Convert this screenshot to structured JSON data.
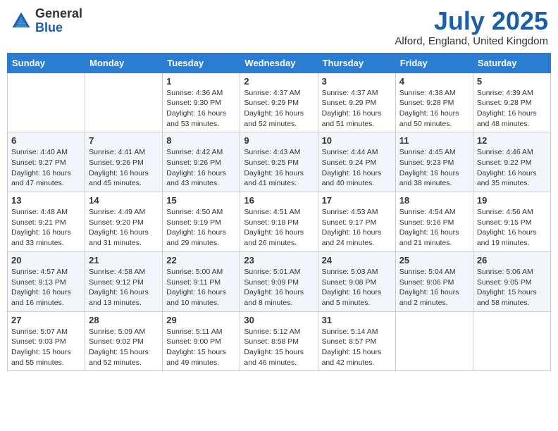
{
  "header": {
    "logo_general": "General",
    "logo_blue": "Blue",
    "month_title": "July 2025",
    "location": "Alford, England, United Kingdom"
  },
  "days_of_week": [
    "Sunday",
    "Monday",
    "Tuesday",
    "Wednesday",
    "Thursday",
    "Friday",
    "Saturday"
  ],
  "weeks": [
    [
      {
        "day": "",
        "info": ""
      },
      {
        "day": "",
        "info": ""
      },
      {
        "day": "1",
        "info": "Sunrise: 4:36 AM\nSunset: 9:30 PM\nDaylight: 16 hours and 53 minutes."
      },
      {
        "day": "2",
        "info": "Sunrise: 4:37 AM\nSunset: 9:29 PM\nDaylight: 16 hours and 52 minutes."
      },
      {
        "day": "3",
        "info": "Sunrise: 4:37 AM\nSunset: 9:29 PM\nDaylight: 16 hours and 51 minutes."
      },
      {
        "day": "4",
        "info": "Sunrise: 4:38 AM\nSunset: 9:28 PM\nDaylight: 16 hours and 50 minutes."
      },
      {
        "day": "5",
        "info": "Sunrise: 4:39 AM\nSunset: 9:28 PM\nDaylight: 16 hours and 48 minutes."
      }
    ],
    [
      {
        "day": "6",
        "info": "Sunrise: 4:40 AM\nSunset: 9:27 PM\nDaylight: 16 hours and 47 minutes."
      },
      {
        "day": "7",
        "info": "Sunrise: 4:41 AM\nSunset: 9:26 PM\nDaylight: 16 hours and 45 minutes."
      },
      {
        "day": "8",
        "info": "Sunrise: 4:42 AM\nSunset: 9:26 PM\nDaylight: 16 hours and 43 minutes."
      },
      {
        "day": "9",
        "info": "Sunrise: 4:43 AM\nSunset: 9:25 PM\nDaylight: 16 hours and 41 minutes."
      },
      {
        "day": "10",
        "info": "Sunrise: 4:44 AM\nSunset: 9:24 PM\nDaylight: 16 hours and 40 minutes."
      },
      {
        "day": "11",
        "info": "Sunrise: 4:45 AM\nSunset: 9:23 PM\nDaylight: 16 hours and 38 minutes."
      },
      {
        "day": "12",
        "info": "Sunrise: 4:46 AM\nSunset: 9:22 PM\nDaylight: 16 hours and 35 minutes."
      }
    ],
    [
      {
        "day": "13",
        "info": "Sunrise: 4:48 AM\nSunset: 9:21 PM\nDaylight: 16 hours and 33 minutes."
      },
      {
        "day": "14",
        "info": "Sunrise: 4:49 AM\nSunset: 9:20 PM\nDaylight: 16 hours and 31 minutes."
      },
      {
        "day": "15",
        "info": "Sunrise: 4:50 AM\nSunset: 9:19 PM\nDaylight: 16 hours and 29 minutes."
      },
      {
        "day": "16",
        "info": "Sunrise: 4:51 AM\nSunset: 9:18 PM\nDaylight: 16 hours and 26 minutes."
      },
      {
        "day": "17",
        "info": "Sunrise: 4:53 AM\nSunset: 9:17 PM\nDaylight: 16 hours and 24 minutes."
      },
      {
        "day": "18",
        "info": "Sunrise: 4:54 AM\nSunset: 9:16 PM\nDaylight: 16 hours and 21 minutes."
      },
      {
        "day": "19",
        "info": "Sunrise: 4:56 AM\nSunset: 9:15 PM\nDaylight: 16 hours and 19 minutes."
      }
    ],
    [
      {
        "day": "20",
        "info": "Sunrise: 4:57 AM\nSunset: 9:13 PM\nDaylight: 16 hours and 16 minutes."
      },
      {
        "day": "21",
        "info": "Sunrise: 4:58 AM\nSunset: 9:12 PM\nDaylight: 16 hours and 13 minutes."
      },
      {
        "day": "22",
        "info": "Sunrise: 5:00 AM\nSunset: 9:11 PM\nDaylight: 16 hours and 10 minutes."
      },
      {
        "day": "23",
        "info": "Sunrise: 5:01 AM\nSunset: 9:09 PM\nDaylight: 16 hours and 8 minutes."
      },
      {
        "day": "24",
        "info": "Sunrise: 5:03 AM\nSunset: 9:08 PM\nDaylight: 16 hours and 5 minutes."
      },
      {
        "day": "25",
        "info": "Sunrise: 5:04 AM\nSunset: 9:06 PM\nDaylight: 16 hours and 2 minutes."
      },
      {
        "day": "26",
        "info": "Sunrise: 5:06 AM\nSunset: 9:05 PM\nDaylight: 15 hours and 58 minutes."
      }
    ],
    [
      {
        "day": "27",
        "info": "Sunrise: 5:07 AM\nSunset: 9:03 PM\nDaylight: 15 hours and 55 minutes."
      },
      {
        "day": "28",
        "info": "Sunrise: 5:09 AM\nSunset: 9:02 PM\nDaylight: 15 hours and 52 minutes."
      },
      {
        "day": "29",
        "info": "Sunrise: 5:11 AM\nSunset: 9:00 PM\nDaylight: 15 hours and 49 minutes."
      },
      {
        "day": "30",
        "info": "Sunrise: 5:12 AM\nSunset: 8:58 PM\nDaylight: 15 hours and 46 minutes."
      },
      {
        "day": "31",
        "info": "Sunrise: 5:14 AM\nSunset: 8:57 PM\nDaylight: 15 hours and 42 minutes."
      },
      {
        "day": "",
        "info": ""
      },
      {
        "day": "",
        "info": ""
      }
    ]
  ]
}
